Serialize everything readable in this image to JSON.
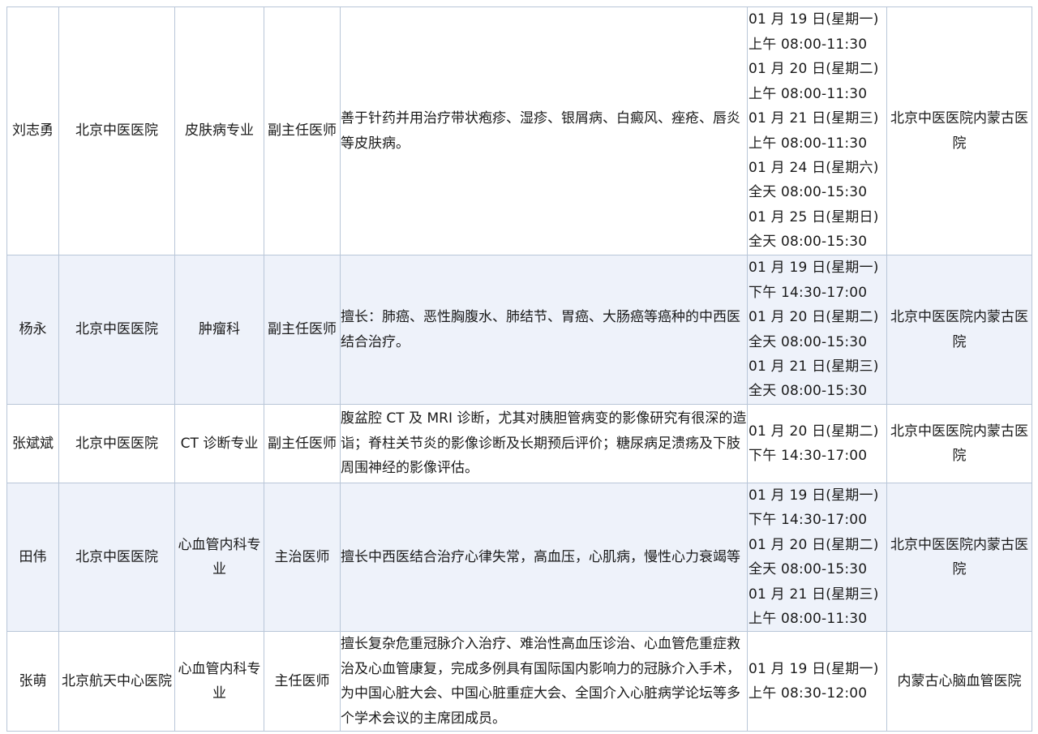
{
  "rows": [
    {
      "name": "刘志勇",
      "hospital": "北京中医医院",
      "department": "皮肤病专业",
      "title": "副主任医师",
      "specialty": "善于针药并用治疗带状疱疹、湿疹、银屑病、白癜风、痤疮、唇炎等皮肤病。",
      "schedule": [
        "01 月 19 日(星期一)",
        "上午 08:00-11:30",
        "01 月 20 日(星期二)",
        "上午 08:00-11:30",
        "01 月 21 日(星期三)",
        "上午 08:00-11:30",
        "01 月 24 日(星期六)",
        "全天 08:00-15:30",
        "01 月 25 日(星期日)",
        "全天 08:00-15:30"
      ],
      "location": "北京中医医院内蒙古医院"
    },
    {
      "name": "杨永",
      "hospital": "北京中医医院",
      "department": "肿瘤科",
      "title": "副主任医师",
      "specialty": "擅长：肺癌、恶性胸腹水、肺结节、胃癌、大肠癌等癌种的中西医结合治疗。",
      "schedule": [
        "01 月 19 日(星期一)",
        "下午 14:30-17:00",
        "01 月 20 日(星期二)",
        "全天 08:00-15:30",
        "01 月 21 日(星期三)",
        "全天 08:00-15:30"
      ],
      "location": "北京中医医院内蒙古医院"
    },
    {
      "name": "张斌斌",
      "hospital": "北京中医医院",
      "department": "CT 诊断专业",
      "title": "副主任医师",
      "specialty": "腹盆腔 CT 及 MRI 诊断，尤其对胰胆管病变的影像研究有很深的造诣；脊柱关节炎的影像诊断及长期预后评价；糖尿病足溃疡及下肢周围神经的影像评估。",
      "schedule": [
        "01 月 20 日(星期二)",
        "下午 14:30-17:00"
      ],
      "location": "北京中医医院内蒙古医院"
    },
    {
      "name": "田伟",
      "hospital": "北京中医医院",
      "department": "心血管内科专业",
      "title": "主治医师",
      "specialty": "擅长中西医结合治疗心律失常，高血压，心肌病，慢性心力衰竭等",
      "schedule": [
        "01 月 19 日(星期一)",
        "下午 14:30-17:00",
        "01 月 20 日(星期二)",
        "全天 08:00-15:30",
        "01 月 21 日(星期三)",
        "上午 08:00-11:30"
      ],
      "location": "北京中医医院内蒙古医院"
    },
    {
      "name": "张萌",
      "hospital": "北京航天中心医院",
      "department": "心血管内科专业",
      "title": "主任医师",
      "specialty": "擅长复杂危重冠脉介入治疗、难治性高血压诊治、心血管危重症救治及心血管康复，完成多例具有国际国内影响力的冠脉介入手术，为中国心脏大会、中国心脏重症大会、全国介入心脏病学论坛等多个学术会议的主席团成员。",
      "schedule": [
        "01 月 19 日(星期一)",
        "上午 08:30-12:00"
      ],
      "location": "内蒙古心脑血管医院"
    }
  ]
}
